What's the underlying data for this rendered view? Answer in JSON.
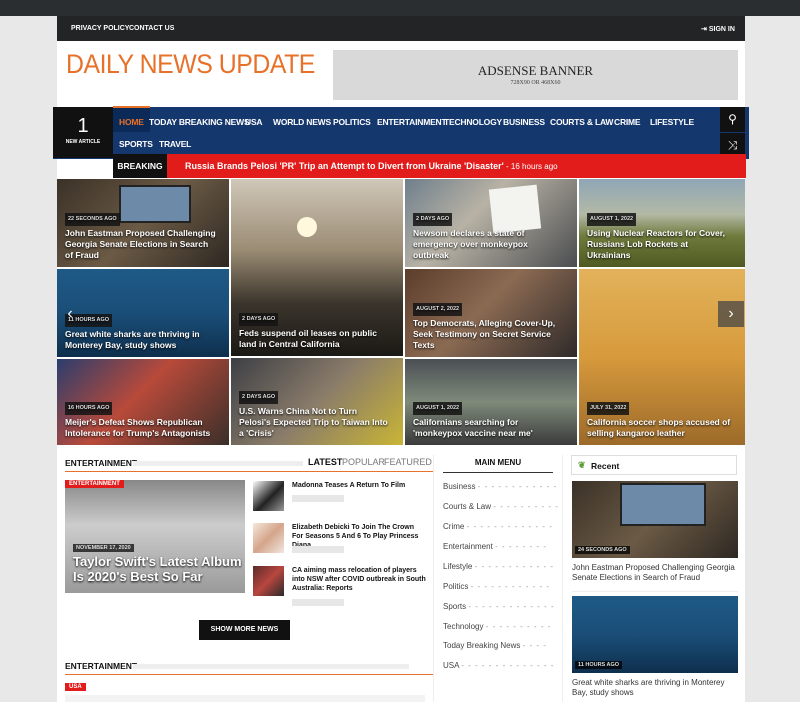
{
  "topbar": {
    "privacy": "PRIVACY POLICY",
    "contact": "CONTACT US",
    "signin": "SIGN IN"
  },
  "logo": "DAILY NEWS UPDATE",
  "ad": {
    "title": "ADSENSE BANNER",
    "size": "728X90 OR 468X60"
  },
  "nav": {
    "count": "1",
    "count_label": "NEW ARTICLE",
    "items": [
      "HOME",
      "TODAY BREAKING NEWS",
      "USA",
      "WORLD NEWS",
      "POLITICS",
      "ENTERTAINMENT",
      "TECHNOLOGY",
      "BUSINESS",
      "COURTS & LAW",
      "CRIME",
      "LIFESTYLE",
      "SPORTS",
      "TRAVEL"
    ]
  },
  "breaking": {
    "label": "BREAKING",
    "headline": "Russia Brands Pelosi 'PR' Trip an Attempt to Divert from Ukraine 'Disaster'",
    "time": " - 16 hours ago"
  },
  "tiles": [
    {
      "badge": "22 SECONDS AGO",
      "title": "John Eastman Proposed Challenging Georgia Senate Elections in Search of Fraud"
    },
    {
      "badge": "2 DAYS AGO",
      "title": "Feds suspend oil leases on public land in Central California"
    },
    {
      "badge": "2 DAYS AGO",
      "title": "Newsom declares a state of emergency over monkeypox outbreak"
    },
    {
      "badge": "AUGUST 1, 2022",
      "title": "Using Nuclear Reactors for Cover, Russians Lob Rockets at Ukrainians"
    },
    {
      "badge": "11 HOURS AGO",
      "title": "Great white sharks are thriving in Monterey Bay, study shows"
    },
    {
      "badge": "AUGUST 2, 2022",
      "title": "Top Democrats, Alleging Cover-Up, Seek Testimony on Secret Service Texts"
    },
    {
      "badge": "JULY 31, 2022",
      "title": "California soccer shops accused of selling kangaroo leather"
    },
    {
      "badge": "16 HOURS AGO",
      "title": "Meijer's Defeat Shows Republican Intolerance for Trump's Antagonists"
    },
    {
      "badge": "2 DAYS AGO",
      "title": "U.S. Warns China Not to Turn Pelosi's Expected Trip to Taiwan Into a 'Crisis'"
    },
    {
      "badge": "AUGUST 1, 2022",
      "title": "Californians searching for 'monkeypox vaccine near me'"
    }
  ],
  "entertainment": {
    "heading": "ENTERTAINMENT",
    "tabs": [
      "LATEST",
      "POPULAR",
      "FEATURED"
    ],
    "main": {
      "category": "ENTERTAINMENT",
      "date": "NOVEMBER 17, 2020",
      "title": "Taylor Swift's Latest Album Is 2020's Best So Far"
    },
    "list": [
      {
        "title": "Madonna Teases A Return To Film"
      },
      {
        "title": "Elizabeth Debicki To Join The Crown For Seasons 5 And 6 To Play Princess Diana"
      },
      {
        "title": "CA aiming mass relocation of players into NSW after COVID outbreak in South Australia: Reports"
      }
    ],
    "show_more": "SHOW MORE NEWS",
    "heading2": "ENTERTAINMENT",
    "tag2": "USA"
  },
  "main_menu": {
    "heading": "MAIN MENU",
    "items": [
      "Business",
      "Courts & Law",
      "Crime",
      "Entertainment",
      "Lifestyle",
      "Politics",
      "Sports",
      "Technology",
      "Today Breaking News",
      "USA"
    ]
  },
  "recent": {
    "heading": "Recent",
    "items": [
      {
        "badge": "24 SECONDS AGO",
        "title": "John Eastman Proposed Challenging Georgia Senate Elections in Search of Fraud"
      },
      {
        "badge": "11 HOURS AGO",
        "title": "Great white sharks are thriving in Monterey Bay, study shows"
      }
    ]
  },
  "colors": {
    "accent": "#e8712a",
    "nav": "#14376e",
    "breaking": "#e21b1b"
  }
}
